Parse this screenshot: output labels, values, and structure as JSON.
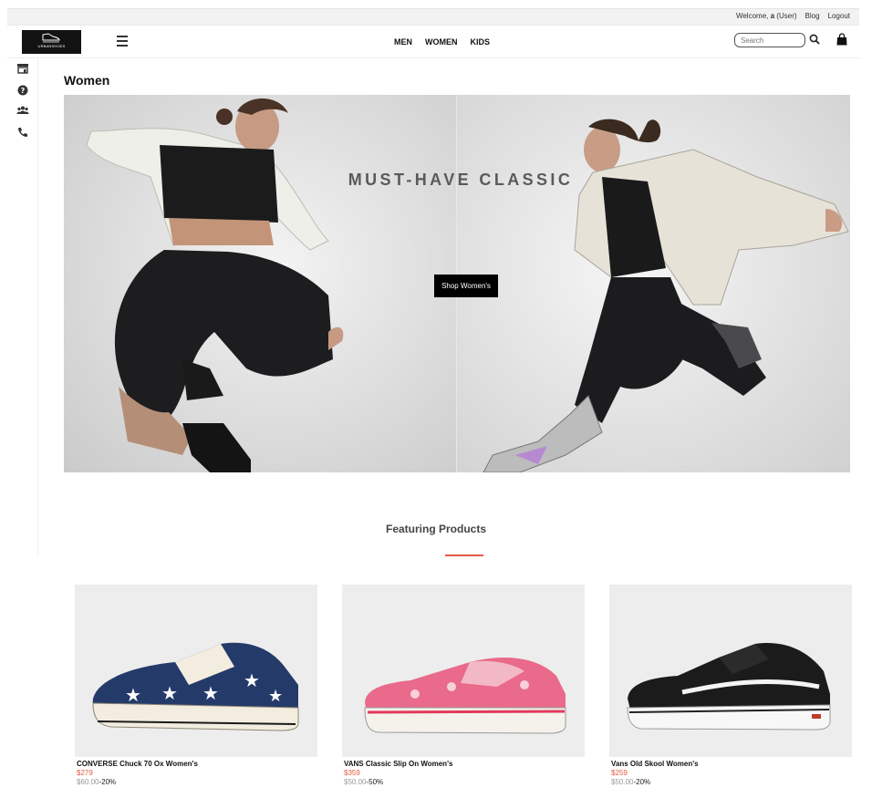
{
  "topbar": {
    "welcome_prefix": "Welcome,",
    "welcome_user_icon": "a",
    "welcome_user": "(User)",
    "blog": "Blog",
    "logout": "Logout"
  },
  "header": {
    "logo_icon": "shoe-logo-icon",
    "logo_text": "URBANSHOES",
    "nav": [
      "MEN",
      "WOMEN",
      "KIDS"
    ],
    "search_placeholder": "Search",
    "icons": [
      "menu-icon",
      "search-icon",
      "shopping-bag-icon"
    ]
  },
  "sidebar": {
    "icons": [
      "store-icon",
      "help-icon",
      "users-icon",
      "phone-icon"
    ]
  },
  "page": {
    "title": "Women"
  },
  "hero": {
    "title": "MUST-HAVE CLASSIC",
    "button": "Shop Women's"
  },
  "featured": {
    "title": "Featuring Products",
    "accent_color": "#e55a40",
    "products": [
      {
        "name": "CONVERSE Chuck 70 Ox Women's",
        "price": "$279",
        "old_price": "$60.00",
        "discount": "-20%"
      },
      {
        "name": "VANS Classic Slip On Women's",
        "price": "$359",
        "old_price": "$50.00",
        "discount": "-50%"
      },
      {
        "name": "Vans Old Skool Women's",
        "price": "$259",
        "old_price": "$50.00",
        "discount": "-20%"
      }
    ]
  }
}
